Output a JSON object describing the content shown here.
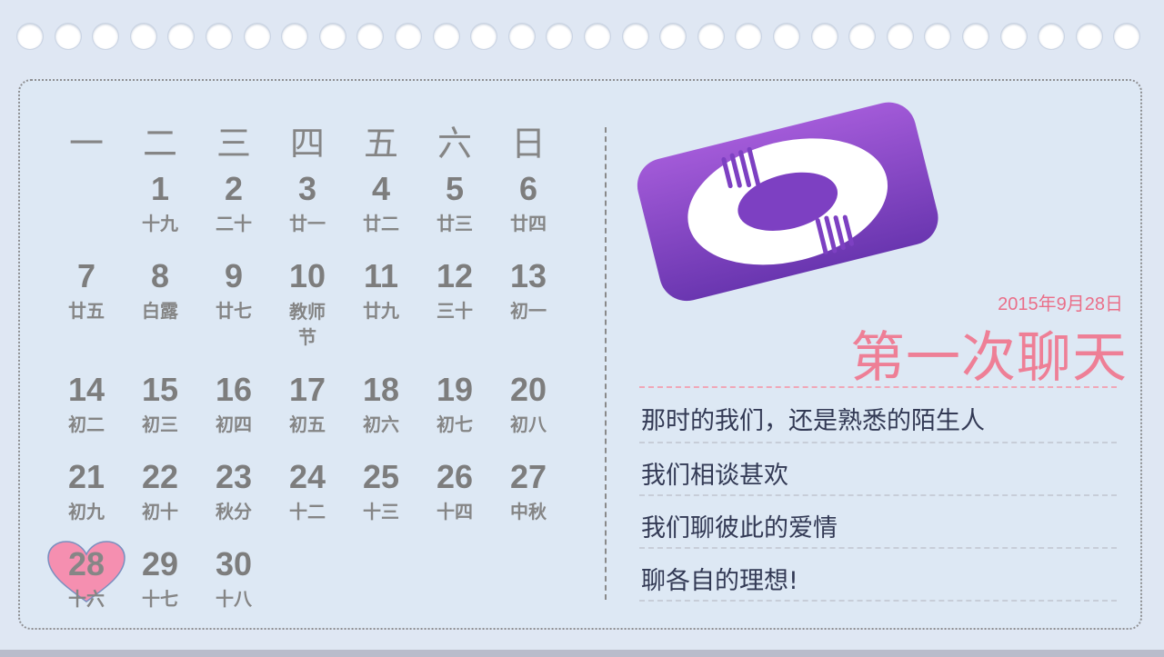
{
  "weekdays": [
    "一",
    "二",
    "三",
    "四",
    "五",
    "六",
    "日"
  ],
  "calendar": {
    "weeks": [
      [
        null,
        {
          "day": "1",
          "lunar": "十九"
        },
        {
          "day": "2",
          "lunar": "二十"
        },
        {
          "day": "3",
          "lunar": "廿一"
        },
        {
          "day": "4",
          "lunar": "廿二"
        },
        {
          "day": "5",
          "lunar": "廿三"
        },
        {
          "day": "6",
          "lunar": "廿四"
        }
      ],
      [
        {
          "day": "7",
          "lunar": "廿五"
        },
        {
          "day": "8",
          "lunar": "白露"
        },
        {
          "day": "9",
          "lunar": "廿七"
        },
        {
          "day": "10",
          "lunar": "教师节"
        },
        {
          "day": "11",
          "lunar": "廿九"
        },
        {
          "day": "12",
          "lunar": "三十"
        },
        {
          "day": "13",
          "lunar": "初一"
        }
      ],
      [
        {
          "day": "14",
          "lunar": "初二"
        },
        {
          "day": "15",
          "lunar": "初三"
        },
        {
          "day": "16",
          "lunar": "初四"
        },
        {
          "day": "17",
          "lunar": "初五"
        },
        {
          "day": "18",
          "lunar": "初六"
        },
        {
          "day": "19",
          "lunar": "初七"
        },
        {
          "day": "20",
          "lunar": "初八"
        }
      ],
      [
        {
          "day": "21",
          "lunar": "初九"
        },
        {
          "day": "22",
          "lunar": "初十"
        },
        {
          "day": "23",
          "lunar": "秋分"
        },
        {
          "day": "24",
          "lunar": "十二"
        },
        {
          "day": "25",
          "lunar": "十三"
        },
        {
          "day": "26",
          "lunar": "十四"
        },
        {
          "day": "27",
          "lunar": "中秋"
        }
      ],
      [
        {
          "day": "28",
          "lunar": "十六",
          "highlight": true
        },
        {
          "day": "29",
          "lunar": "十七"
        },
        {
          "day": "30",
          "lunar": "十八"
        },
        null,
        null,
        null,
        null
      ]
    ]
  },
  "event": {
    "date": "2015年9月28日",
    "title": "第一次聊天",
    "lines": [
      "那时的我们，还是熟悉的陌生人",
      "我们相谈甚欢",
      "我们聊彼此的爱情",
      "聊各自的理想!"
    ]
  },
  "colors": {
    "background": "#dfe7f3",
    "accent_pink": "#ee7f96",
    "heart": "#f58fb0",
    "icon_purple": "#7a3fbf"
  },
  "icons": {
    "app_icon": "chat-app-icon",
    "heart": "heart-icon"
  }
}
